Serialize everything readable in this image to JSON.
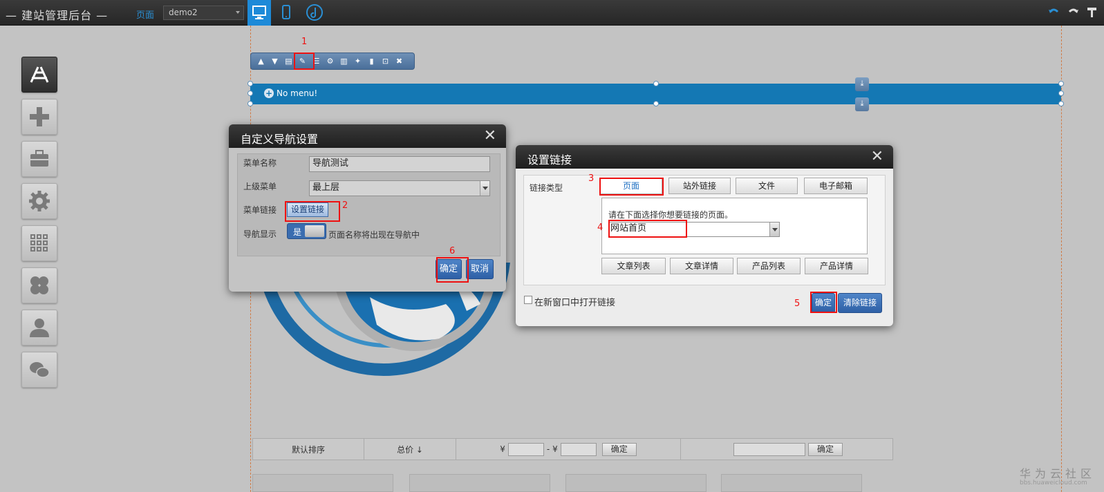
{
  "topbar": {
    "brand": "— 建站管理后台 —",
    "page_label": "页面",
    "page_select": "demo2"
  },
  "sidebar": {
    "items": [
      {
        "icon": "app-store-icon"
      },
      {
        "icon": "plus-icon"
      },
      {
        "icon": "toolbox-icon"
      },
      {
        "icon": "gear-icon"
      },
      {
        "icon": "grid-icon"
      },
      {
        "icon": "clover-icon"
      },
      {
        "icon": "user-icon"
      },
      {
        "icon": "wechat-icon"
      }
    ]
  },
  "canvas": {
    "nav_placeholder": "No menu!"
  },
  "filter_bar": {
    "default_sort": "默认排序",
    "total_price": "总价 ↓",
    "yen1": "¥",
    "dash": "- ¥",
    "confirm1": "确定",
    "confirm2": "确定"
  },
  "watermark": {
    "title": "华为云社区",
    "url": "bbs.huaweicloud.com"
  },
  "nav_dialog": {
    "title": "自定义导航设置",
    "menu_name_label": "菜单名称",
    "menu_name_value": "导航测试",
    "parent_menu_label": "上级菜单",
    "parent_menu_value": "最上层",
    "menu_link_label": "菜单链接",
    "set_link_button": "设置链接",
    "nav_display_label": "导航显示",
    "toggle_on": "是",
    "nav_display_hint": "页面名称将出现在导航中",
    "ok_button": "确定",
    "cancel_button": "取消"
  },
  "link_dialog": {
    "title": "设置链接",
    "link_type_label": "链接类型",
    "tabs": [
      "页面",
      "站外链接",
      "文件",
      "电子邮箱"
    ],
    "prompt": "请在下面选择你想要链接的页面。",
    "page_select_value": "网站首页",
    "quick_buttons": [
      "文章列表",
      "文章详情",
      "产品列表",
      "产品详情"
    ],
    "new_window_label": "在新窗口中打开链接",
    "ok_button": "确定",
    "clear_button": "清除链接"
  },
  "annotations": [
    "1",
    "2",
    "3",
    "4",
    "5",
    "6"
  ],
  "colors": {
    "accent": "#1d8ad8",
    "highlight": "#e11111",
    "nav_bar": "#1478b4"
  }
}
